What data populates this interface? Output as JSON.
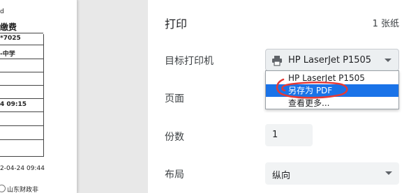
{
  "preview": {
    "line1": "d",
    "title": "缴费",
    "row1": "*7025",
    "row2": "-中学",
    "row3": "4 09:15",
    "row4": "2-04-24 09:44",
    "footer": "山东财政非"
  },
  "panel": {
    "title": "打印",
    "sheet_count": "1 张纸",
    "destination_label": "目标打印机",
    "pages_label": "页面",
    "copies_label": "份数",
    "layout_label": "布局"
  },
  "destination": {
    "selected": "HP LaserJet P1505",
    "icon": "printer-icon"
  },
  "dropdown": {
    "options": [
      "HP LaserJet P1505",
      "另存为 PDF",
      "查看更多..."
    ],
    "highlighted_index": 1
  },
  "copies": {
    "value": "1"
  },
  "layout": {
    "value": "纵向"
  },
  "colors": {
    "highlight": "#1a73e8",
    "annotation": "#e53935",
    "preview_bg": "#e8e8e8"
  }
}
